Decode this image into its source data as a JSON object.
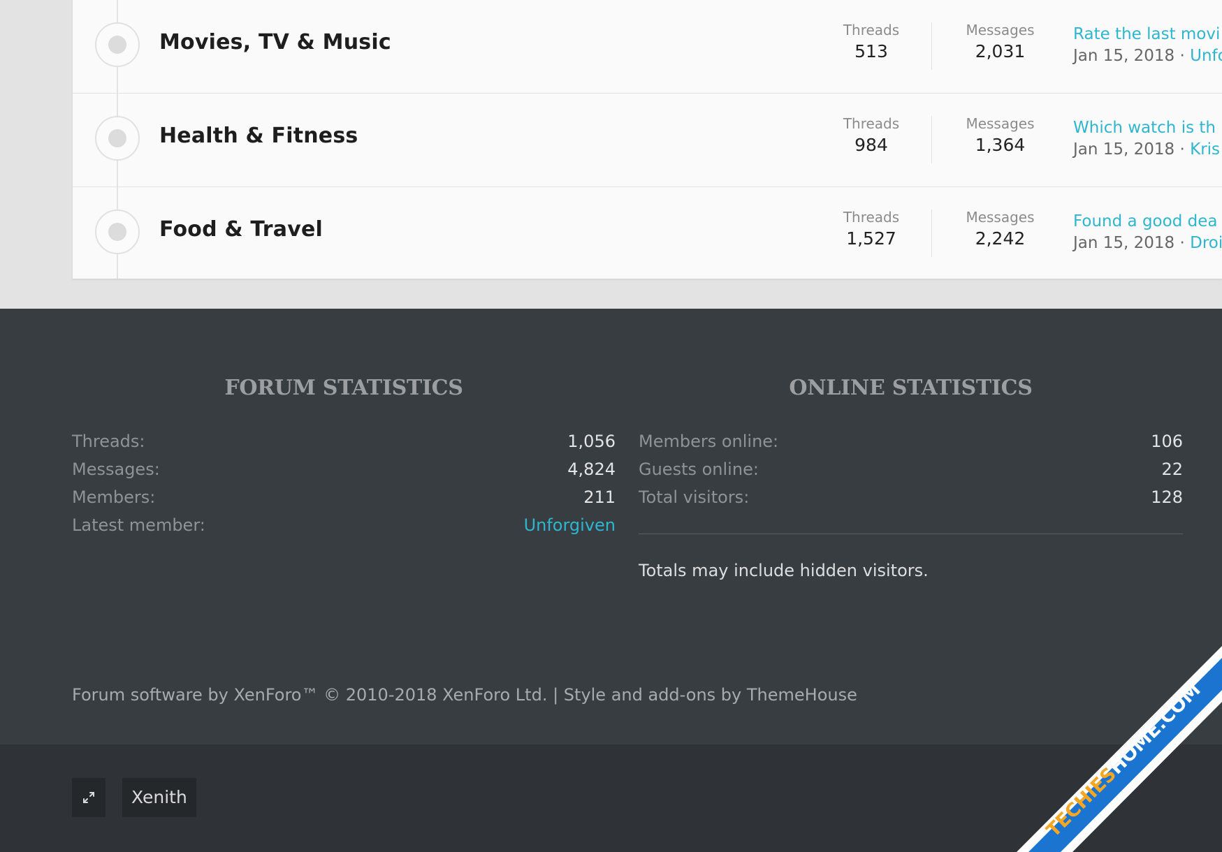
{
  "forums": [
    {
      "title": "Movies, TV & Music",
      "threads_label": "Threads",
      "threads": "513",
      "messages_label": "Messages",
      "messages": "2,031",
      "last_post_title": "Rate the last movi",
      "last_post_date": "Jan 15, 2018 · ",
      "last_post_user": "Unfo"
    },
    {
      "title": "Health & Fitness",
      "threads_label": "Threads",
      "threads": "984",
      "messages_label": "Messages",
      "messages": "1,364",
      "last_post_title": "Which watch is th",
      "last_post_date": "Jan 15, 2018 · ",
      "last_post_user": "Kris"
    },
    {
      "title": "Food & Travel",
      "threads_label": "Threads",
      "threads": "1,527",
      "messages_label": "Messages",
      "messages": "2,242",
      "last_post_title": "Found a good dea",
      "last_post_date": "Jan 15, 2018 · ",
      "last_post_user": "Droi"
    }
  ],
  "forum_statistics": {
    "heading": "FORUM STATISTICS",
    "rows": [
      {
        "label": "Threads:",
        "value": "1,056"
      },
      {
        "label": "Messages:",
        "value": "4,824"
      },
      {
        "label": "Members:",
        "value": "211"
      },
      {
        "label": "Latest member:",
        "value": "Unforgiven"
      }
    ]
  },
  "online_statistics": {
    "heading": "ONLINE STATISTICS",
    "rows": [
      {
        "label": "Members online:",
        "value": "106"
      },
      {
        "label": "Guests online:",
        "value": "22"
      },
      {
        "label": "Total visitors:",
        "value": "128"
      }
    ],
    "note": "Totals may include hidden visitors."
  },
  "copyright": "Forum software by XenForo™ © 2010-2018 XenForo Ltd. | Style and add-ons by ThemeHouse",
  "footer_bottom": {
    "expand_icon": "expand-arrows-icon",
    "style_label": "Xenith"
  },
  "watermark": {
    "text": "TECHIESHOME.COM",
    "color": "#1b75d0",
    "text_color": "#ffffff",
    "accent_color": "#f5a623"
  },
  "colors": {
    "link": "#2eb6cf",
    "footer_bg": "#383d41",
    "footer_bottom_bg": "#2f3337",
    "page_bg": "#e3e3e3"
  }
}
